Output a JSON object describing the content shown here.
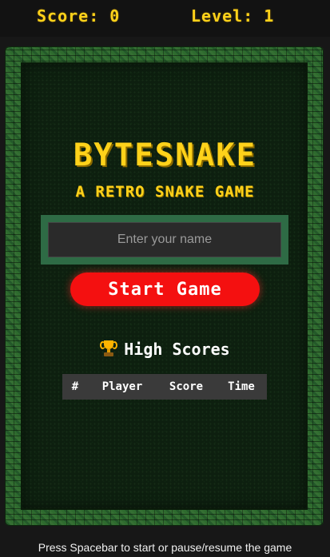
{
  "header": {
    "score_label": "Score: 0",
    "level_label": "Level: 1"
  },
  "menu": {
    "title": "BYTESNAKE",
    "subtitle": "A RETRO SNAKE GAME",
    "name_value": "",
    "name_placeholder": "Enter your name",
    "start_label": "Start Game"
  },
  "high_scores": {
    "icon": "trophy-icon",
    "title": "High Scores",
    "columns": [
      "#",
      "Player",
      "Score",
      "Time"
    ],
    "rows": []
  },
  "footer": {
    "hint": "Press Spacebar to start or pause/resume the game"
  },
  "colors": {
    "accent_yellow": "#ffd21a",
    "button_red": "#f41010",
    "input_frame_green": "#2e6b45",
    "background": "#171717"
  }
}
